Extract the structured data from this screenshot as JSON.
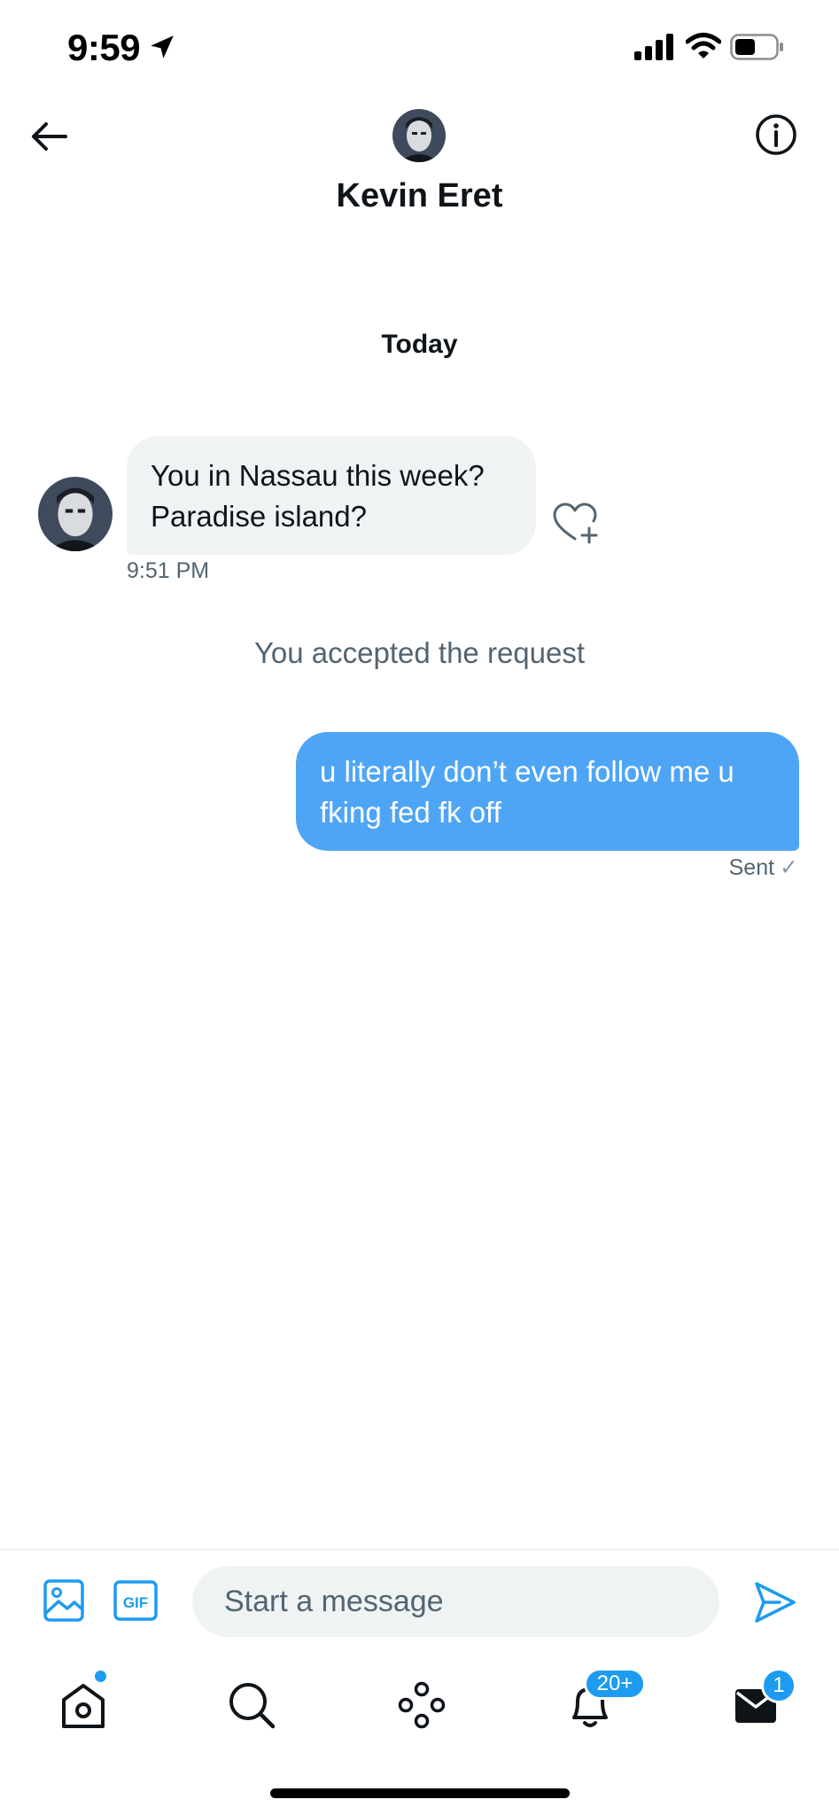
{
  "status_bar": {
    "time": "9:59",
    "icons": [
      "location-arrow-icon",
      "signal-bars-icon",
      "wifi-icon",
      "battery-icon"
    ]
  },
  "header": {
    "contact_name": "Kevin Eret",
    "icons": [
      "back-arrow-icon",
      "info-icon"
    ]
  },
  "conversation": {
    "day_label": "Today",
    "messages": [
      {
        "direction": "incoming",
        "lines": [
          "You in Nassau this week?",
          "Paradise island?"
        ],
        "time": "9:51 PM"
      },
      {
        "direction": "system",
        "text": "You accepted the request"
      },
      {
        "direction": "outgoing",
        "lines": [
          "u literally don’t even follow me u",
          "fking fed fk off"
        ],
        "status": "Sent",
        "status_mark": "✓"
      }
    ]
  },
  "composer": {
    "placeholder": "Start a message",
    "gif_label": "GIF"
  },
  "tab_bar": {
    "tabs": [
      "home",
      "search",
      "spaces",
      "notifications",
      "messages"
    ],
    "notifications_badge": "20+",
    "messages_badge": "1"
  },
  "colors": {
    "accent": "#1d9bf0",
    "outgoing_bubble": "#4fa5f5",
    "incoming_bubble": "#eff3f4",
    "secondary_text": "#536471"
  }
}
